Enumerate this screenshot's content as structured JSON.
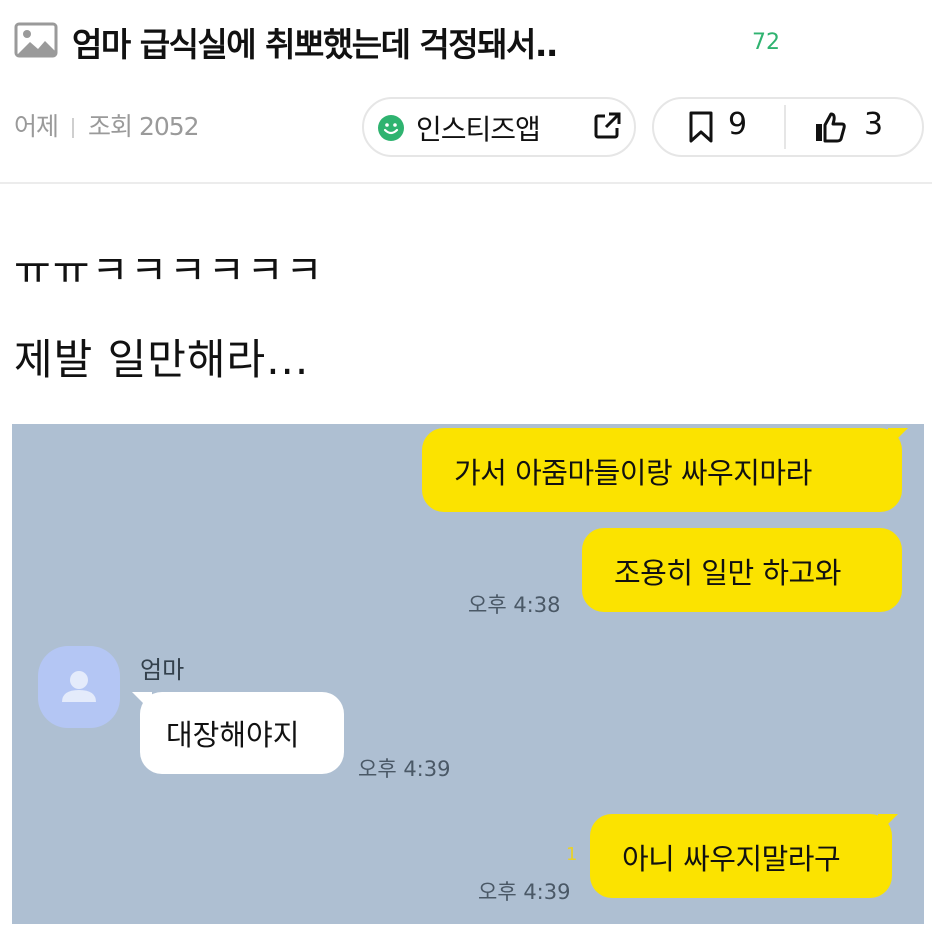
{
  "post": {
    "title": "엄마 급식실에 취뽀했는데 걱정돼서..",
    "comment_count": "72",
    "date": "어제",
    "views": "조회 2052",
    "source_label": "인스티즈앱",
    "bookmark_count": "9",
    "like_count": "3"
  },
  "body": {
    "line1": "ㅠㅠㅋㅋㅋㅋㅋㅋ",
    "line2": "제발 일만해라..."
  },
  "chat": {
    "messages": [
      {
        "side": "me",
        "text": "가서 아줌마들이랑 싸우지마라"
      },
      {
        "side": "me",
        "text": "조용히 일만 하고와",
        "time": "오후 4:38"
      },
      {
        "side": "other",
        "sender": "엄마",
        "text": "대장해야지",
        "time": "오후 4:39"
      },
      {
        "side": "me",
        "text": "아니 싸우지말라구",
        "time": "오후 4:39",
        "unread": "1"
      }
    ]
  },
  "colors": {
    "accent_green": "#2fb370",
    "chat_bg": "#aebfd2",
    "my_bubble": "#fbe300",
    "other_bubble": "#ffffff"
  },
  "icons": [
    "image-icon",
    "smile-icon",
    "external-link-icon",
    "bookmark-icon",
    "thumbs-up-icon",
    "avatar-icon"
  ]
}
